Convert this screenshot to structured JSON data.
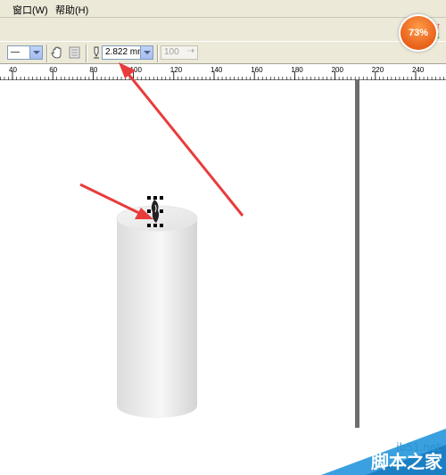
{
  "menu": {
    "items": [
      {
        "label": "窗口(W)"
      },
      {
        "label": "帮助(H)"
      }
    ]
  },
  "toolbar": {
    "line_style_value": "—",
    "outline_width_value": "2.822 mm",
    "scale_value": "100"
  },
  "ruler": {
    "ticks": [
      "40",
      "60",
      "80",
      "100",
      "120",
      "140",
      "160",
      "180",
      "200",
      "220",
      "240"
    ]
  },
  "overlay": {
    "zoom_badge": "73%"
  },
  "watermark": {
    "site": "jb51.net",
    "name": "脚本之家"
  }
}
